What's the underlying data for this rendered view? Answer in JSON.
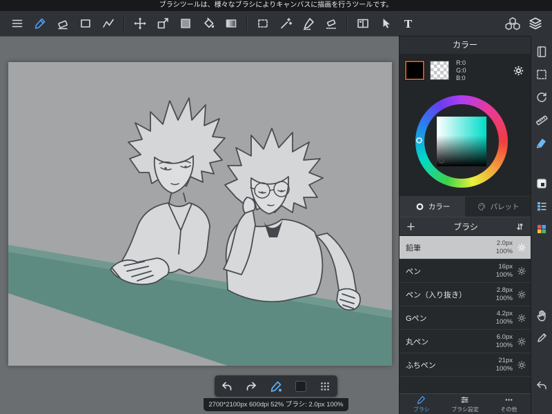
{
  "colors": {
    "accent_blue": "#4aa3f7",
    "workspace_gray": "#6b6e70",
    "toolbar_dark": "#2f3337",
    "panel_dark": "#26292c",
    "canvas_gray": "#a3a5a6",
    "table_teal": "#5e8b81",
    "selected_row": "#c6c8ca",
    "fg_swatch": "#000000",
    "sv_hue": "#00dcc8",
    "swatch_active_border": "#c25a2a"
  },
  "tooltip_bar": {
    "text": "ブラシツールは、様々なブラシによりキャンバスに描画を行うツールです。"
  },
  "toolbar": {
    "tools": [
      "menu",
      "brush",
      "eraser",
      "shape",
      "polyline",
      "move",
      "transform",
      "color-chip",
      "bucket",
      "gradient",
      "marquee-select",
      "magic-wand",
      "pen-select",
      "eraser-select",
      "panel-layout",
      "object-select",
      "text",
      "material",
      "layers"
    ],
    "text_tool_label": "T",
    "active_tool": "brush"
  },
  "color_panel": {
    "title": "カラー",
    "rgb_labels": [
      "R:0",
      "G:0",
      "B:0"
    ],
    "tabs": [
      {
        "label": "カラー",
        "selected": true
      },
      {
        "label": "パレット",
        "selected": false
      }
    ]
  },
  "brush_panel": {
    "title": "ブラシ",
    "brushes": [
      {
        "name": "鉛筆",
        "size": "2.0px",
        "opacity": "100%",
        "selected": true
      },
      {
        "name": "ペン",
        "size": "16px",
        "opacity": "100%",
        "selected": false
      },
      {
        "name": "ペン（入り抜き）",
        "size": "2.8px",
        "opacity": "100%",
        "selected": false
      },
      {
        "name": "Gペン",
        "size": "4.2px",
        "opacity": "100%",
        "selected": false
      },
      {
        "name": "丸ペン",
        "size": "6.0px",
        "opacity": "100%",
        "selected": false
      },
      {
        "name": "ふちペン",
        "size": "21px",
        "opacity": "100%",
        "selected": false
      }
    ]
  },
  "bottom_tabs": [
    {
      "label": "ブラシ",
      "selected": true
    },
    {
      "label": "ブラシ設定",
      "selected": false
    },
    {
      "label": "その他",
      "selected": false
    }
  ],
  "side_toolbar": {
    "tools": [
      "journal",
      "select-area",
      "rotate-canvas",
      "ruler",
      "marker",
      "color-chip-panel",
      "layer-list-panel",
      "palette-panel",
      "hand",
      "stylus",
      "undo"
    ]
  },
  "quick_toolbar": {
    "tools": [
      "undo",
      "redo",
      "brush-eyedropper",
      "color-chip",
      "drag-handle"
    ]
  },
  "status_bar": {
    "text": "2700*2100px 600dpi 52% ブラシ: 2.0px 100%"
  }
}
